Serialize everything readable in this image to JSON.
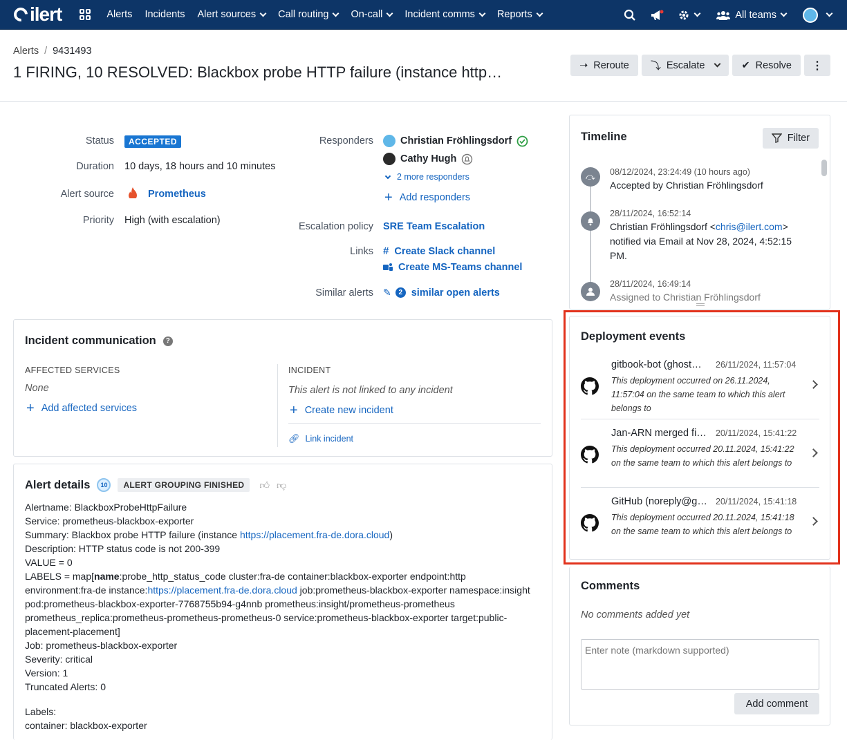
{
  "brand": {
    "name": "ilert"
  },
  "nav": {
    "items": [
      {
        "label": "Alerts",
        "dropdown": false
      },
      {
        "label": "Incidents",
        "dropdown": false
      },
      {
        "label": "Alert sources",
        "dropdown": true
      },
      {
        "label": "Call routing",
        "dropdown": true
      },
      {
        "label": "On-call",
        "dropdown": true
      },
      {
        "label": "Incident comms",
        "dropdown": true
      },
      {
        "label": "Reports",
        "dropdown": true
      }
    ],
    "teams_label": "All teams"
  },
  "breadcrumb": {
    "root": "Alerts",
    "sep": "/",
    "id": "9431493"
  },
  "title": "1 FIRING, 10 RESOLVED: Blackbox probe HTTP failure (instance http…",
  "actions": {
    "reroute": "Reroute",
    "escalate": "Escalate",
    "resolve": "Resolve"
  },
  "details": {
    "status_label": "Status",
    "status_value": "ACCEPTED",
    "duration_label": "Duration",
    "duration_value": "10 days, 18 hours and 10 minutes",
    "source_label": "Alert source",
    "source_value": "Prometheus",
    "priority_label": "Priority",
    "priority_value": "High (with escalation)",
    "responders_label": "Responders",
    "responders": [
      "Christian Fröhlingsdorf",
      "Cathy Hugh"
    ],
    "more_responders": "2 more responders",
    "add_responders": "Add responders",
    "escalation_label": "Escalation policy",
    "escalation_value": "SRE Team Escalation",
    "links_label": "Links",
    "link_slack": "Create Slack channel",
    "link_teams": "Create MS-Teams channel",
    "similar_label": "Similar alerts",
    "similar_count": "2",
    "similar_value": "similar open alerts"
  },
  "incident_comm": {
    "title": "Incident communication",
    "affected_label": "AFFECTED SERVICES",
    "affected_value": "None",
    "add_affected": "Add affected services",
    "incident_label": "INCIDENT",
    "incident_value": "This alert is not linked to any incident",
    "create_incident": "Create new incident",
    "link_incident": "Link incident"
  },
  "alert_details": {
    "title": "Alert details",
    "count": "10",
    "grouping": "ALERT GROUPING FINISHED",
    "lines": [
      "Alertname: BlackboxProbeHttpFailure",
      "Service: prometheus-blackbox-exporter"
    ],
    "summary_prefix": "Summary: Blackbox probe HTTP failure (instance ",
    "summary_link": "https://placement.fra-de.dora.cloud",
    "summary_suffix": ")",
    "lines2": [
      "Description: HTTP status code is not 200-399",
      "VALUE = 0"
    ],
    "labels_prefix": "LABELS = map[",
    "labels_bold": "name",
    "labels_1": ":probe_http_status_code cluster:fra-de container:blackbox-exporter endpoint:http environment:fra-de instance:",
    "labels_link": "https://placement.fra-de.dora.cloud",
    "labels_2": " job:prometheus-blackbox-exporter namespace:insight pod:prometheus-blackbox-exporter-7768755b94-g4nnb prometheus:insight/prometheus-prometheus prometheus_replica:prometheus-prometheus-prometheus-0 service:prometheus-blackbox-exporter target:public-placement-placement]",
    "lines3": [
      "Job: prometheus-blackbox-exporter",
      "Severity: critical",
      "Version: 1",
      "Truncated Alerts: 0"
    ],
    "labels_head": "Labels:",
    "labels_line": "container: blackbox-exporter"
  },
  "timeline": {
    "title": "Timeline",
    "filter": "Filter",
    "items": [
      {
        "date": "08/12/2024, 23:24:49 (10 hours ago)",
        "text": "Accepted by Christian Fröhlingsdorf"
      },
      {
        "date": "28/11/2024, 16:52:14",
        "text_prefix": "Christian Fröhlingsdorf <",
        "email": "chris@ilert.com",
        "text_suffix": "> notified via Email at Nov 28, 2024, 4:52:15 PM."
      },
      {
        "date": "28/11/2024, 16:49:14",
        "text": "Assigned to Christian Fröhlingsdorf"
      }
    ]
  },
  "deployments": {
    "title": "Deployment events",
    "items": [
      {
        "name": "gitbook-bot (ghost…",
        "date": "26/11/2024, 11:57:04",
        "desc": "This deployment occurred on 26.11.2024, 11:57:04 on the same team to which this alert belongs to"
      },
      {
        "name": "Jan-ARN merged fi…",
        "date": "20/11/2024, 15:41:22",
        "desc": "This deployment occurred 20.11.2024, 15:41:22 on the same team to which this alert belongs to"
      },
      {
        "name": "GitHub (noreply@gi…",
        "date": "20/11/2024, 15:41:18",
        "desc": "This deployment occurred 20.11.2024, 15:41:18 on the same team to which this alert belongs to"
      }
    ]
  },
  "comments": {
    "title": "Comments",
    "empty": "No comments added yet",
    "placeholder": "Enter note (markdown supported)",
    "add": "Add comment"
  }
}
